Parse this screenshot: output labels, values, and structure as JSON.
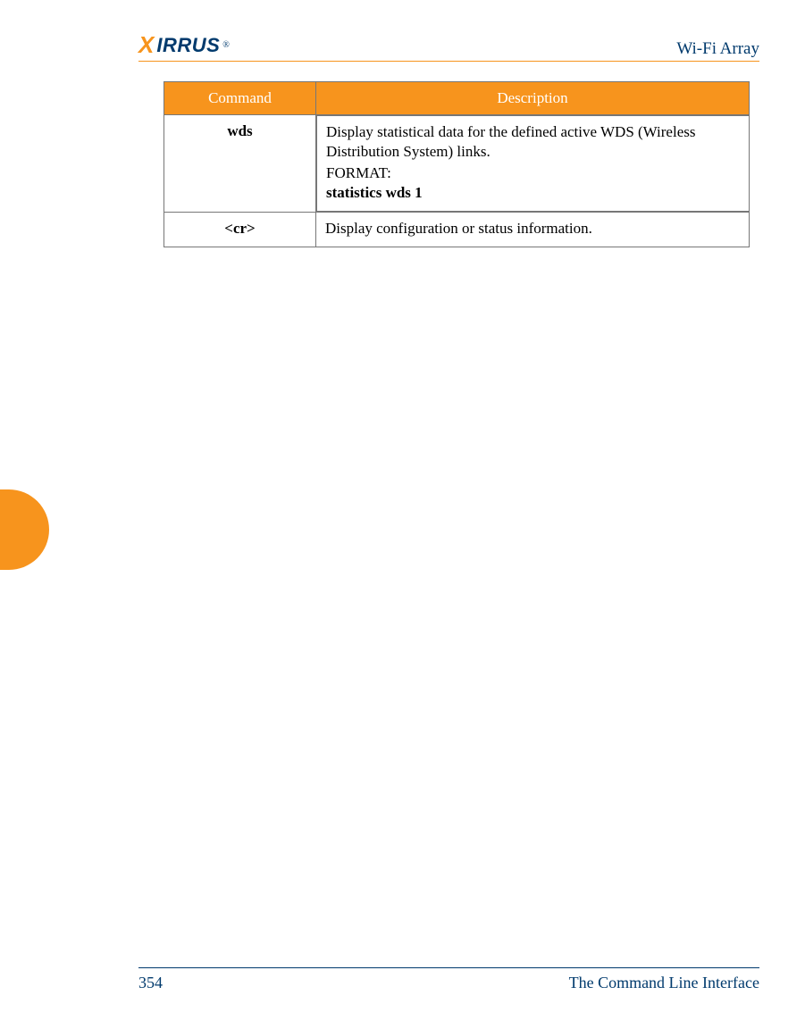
{
  "header": {
    "logo_brand_x": "X",
    "logo_brand_rest": "IRRUS",
    "doc_title": "Wi-Fi Array"
  },
  "table": {
    "headers": {
      "command": "Command",
      "description": "Description"
    },
    "rows": [
      {
        "command": "wds",
        "description": "Display statistical data for the defined active WDS (Wireless Distribution System) links.",
        "format_label": "FORMAT:",
        "format_value": "statistics wds 1"
      },
      {
        "command": "<cr>",
        "description": "Display configuration or status information."
      }
    ]
  },
  "footer": {
    "page_number": "354",
    "section": "The Command Line Interface"
  }
}
